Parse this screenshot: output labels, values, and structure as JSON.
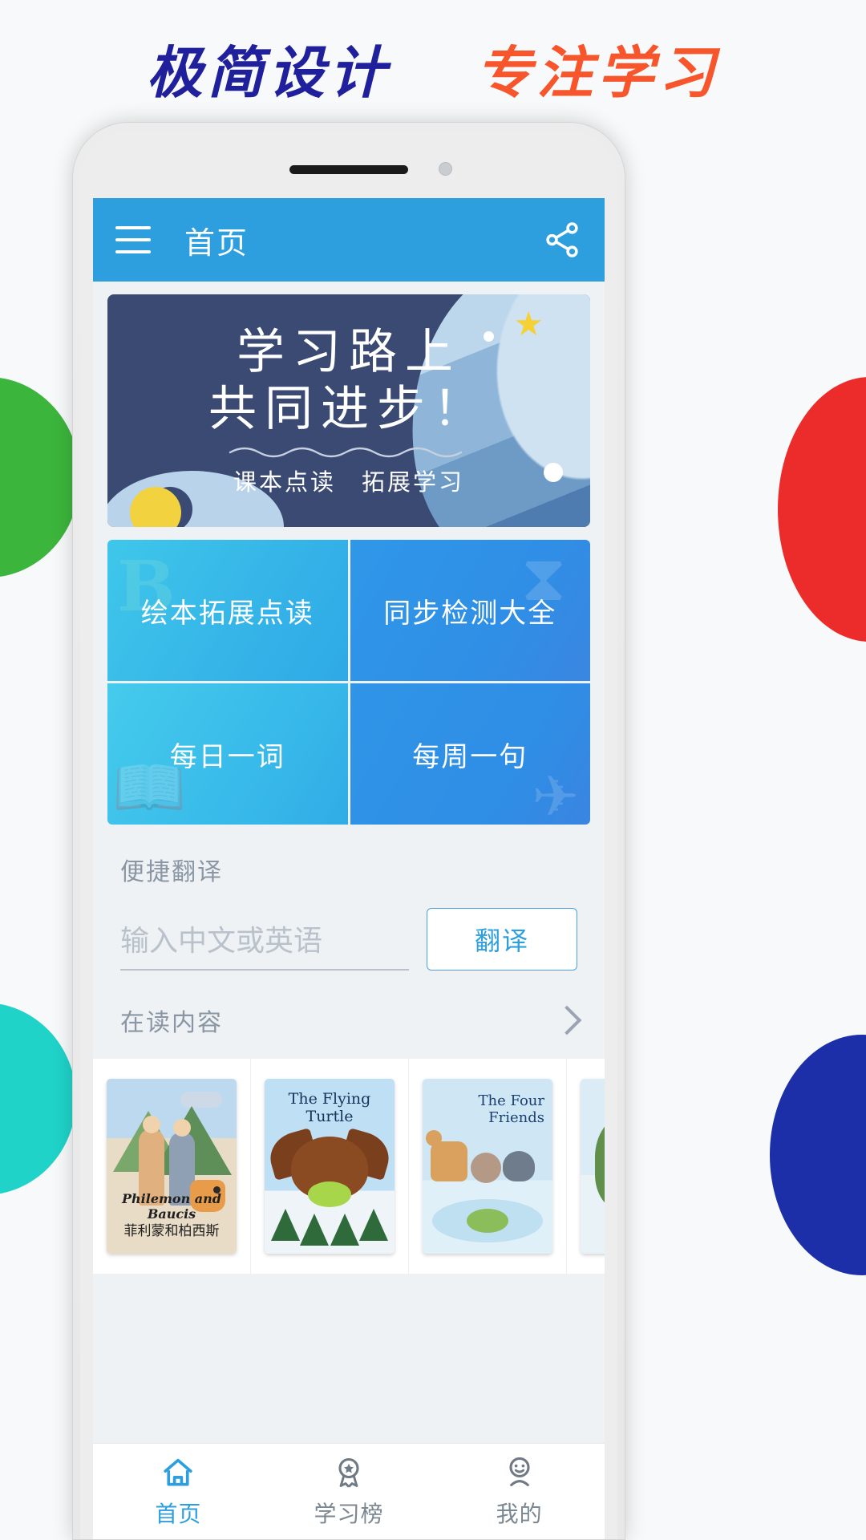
{
  "headline": {
    "left": "极简设计",
    "right": "专注学习"
  },
  "colors": {
    "accent_blue": "#2d9ede",
    "headline_blue": "#20209c",
    "headline_orange": "#f7552b",
    "banner_navy": "#3a4a73",
    "blob_green": "#3cb53c",
    "blob_teal": "#1fd3c8",
    "blob_red": "#ec2b2b",
    "blob_navy": "#1d2fa8"
  },
  "appbar": {
    "menu_icon": "hamburger-menu-icon",
    "title": "首页",
    "share_icon": "share-icon"
  },
  "banner": {
    "line1": "学习路上",
    "line2": "共同进步！",
    "subtitle": "课本点读　拓展学习",
    "star_icon": "star-icon",
    "moon_icon": "moon-icon"
  },
  "tiles": [
    {
      "label": "绘本拓展点读",
      "deco": "abc-blocks-icon"
    },
    {
      "label": "同步检测大全",
      "deco": "hourglass-icon"
    },
    {
      "label": "每日一词",
      "deco": "book-icon"
    },
    {
      "label": "每周一句",
      "deco": "paper-plane-icon"
    }
  ],
  "translate": {
    "label": "便捷翻译",
    "input_value": "",
    "placeholder": "输入中文或英语",
    "button": "翻译"
  },
  "reading": {
    "label": "在读内容",
    "more_icon": "chevron-right-icon",
    "cards": [
      {
        "title_en": "Philemon and Baucis",
        "title_cn": "菲利蒙和柏西斯"
      },
      {
        "title_en": "The Flying Turtle",
        "title_cn": ""
      },
      {
        "title_en": "The Four Friends",
        "title_cn": ""
      },
      {
        "title_en": "",
        "title_cn": ""
      }
    ]
  },
  "tabbar": [
    {
      "label": "首页",
      "icon": "home-icon",
      "active": true
    },
    {
      "label": "学习榜",
      "icon": "medal-icon",
      "active": false
    },
    {
      "label": "我的",
      "icon": "person-icon",
      "active": false
    }
  ]
}
